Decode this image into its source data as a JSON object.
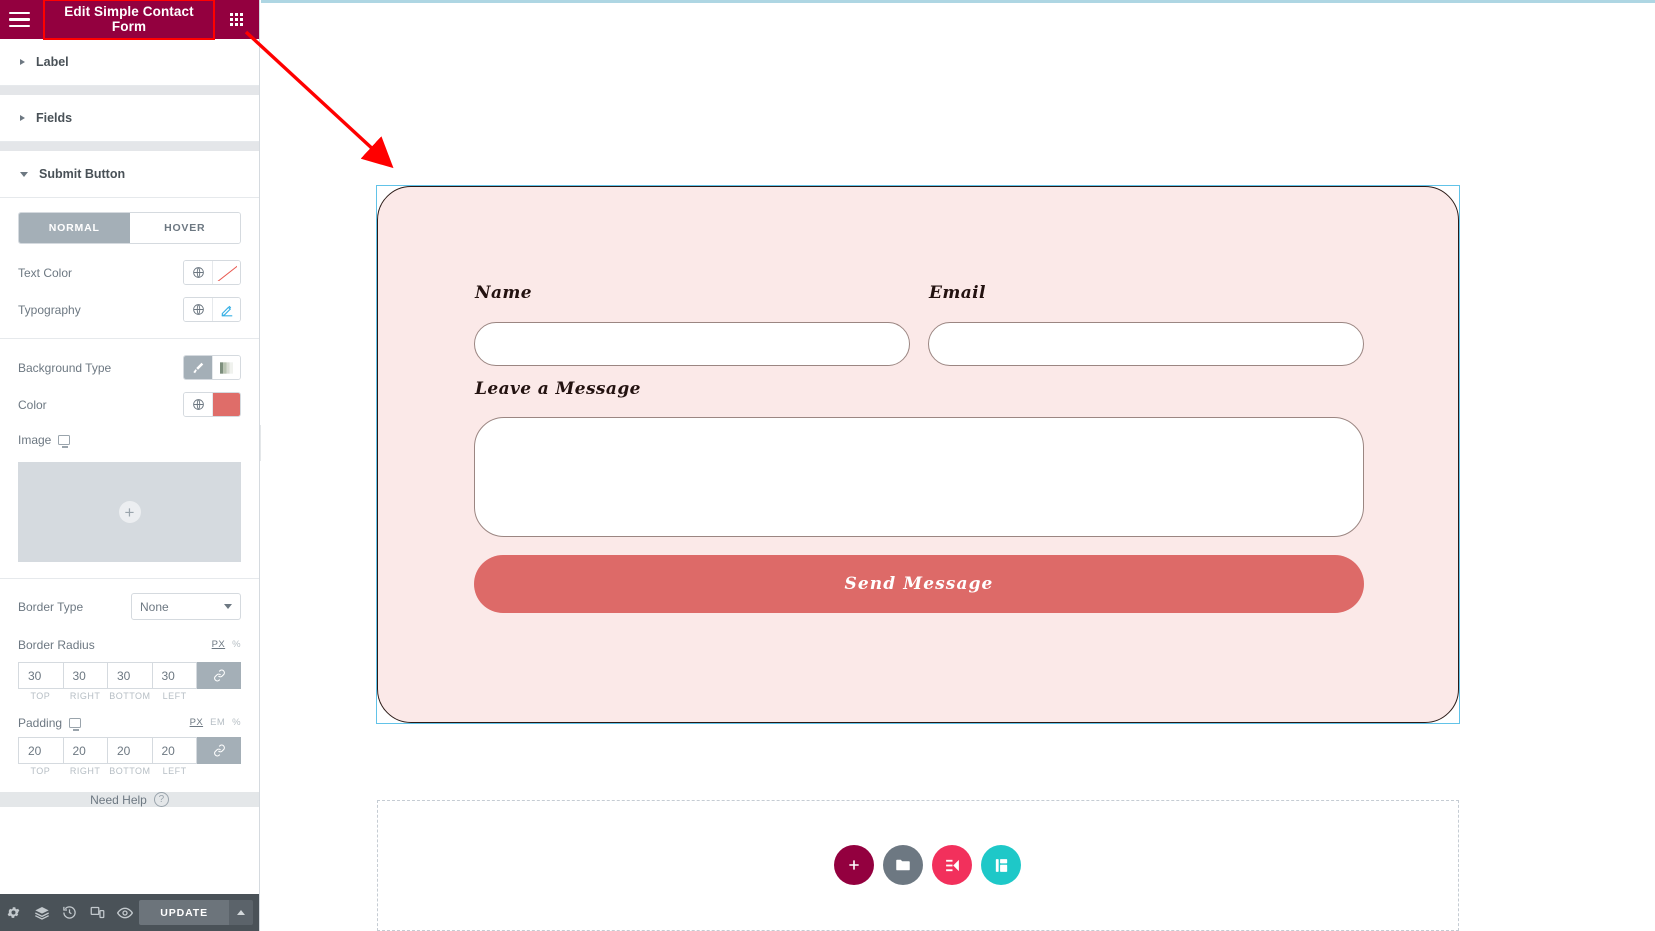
{
  "panel": {
    "header": {
      "title": "Edit Simple Contact Form",
      "menu_icon": "hamburger-icon",
      "grid_icon": "widgets-grid-icon",
      "background_color": "#93003f",
      "highlight_color": "#ff0000"
    },
    "sections": [
      {
        "label": "Label",
        "expanded": false
      },
      {
        "label": "Fields",
        "expanded": false
      },
      {
        "label": "Submit Button",
        "expanded": true
      }
    ],
    "submit_button": {
      "tabs": [
        {
          "label": "NORMAL",
          "active": true
        },
        {
          "label": "HOVER",
          "active": false
        }
      ],
      "controls": {
        "text_color": {
          "label": "Text Color",
          "globe_icon": "globe-icon",
          "value_icon": "no-color-slash-icon"
        },
        "typography": {
          "label": "Typography",
          "globe_icon": "globe-icon",
          "value_icon": "pencil-edit-icon"
        },
        "background_type": {
          "label": "Background Type",
          "options": [
            {
              "icon": "brush-classic-icon",
              "selected": true
            },
            {
              "icon": "gradient-icon",
              "selected": false
            }
          ]
        },
        "color": {
          "label": "Color",
          "globe_icon": "globe-icon",
          "swatch": "#d9534f"
        },
        "image": {
          "label": "Image",
          "device_icon": "desktop-icon",
          "add_icon": "plus-icon"
        },
        "border_type": {
          "label": "Border Type",
          "value": "None"
        },
        "border_radius": {
          "label": "Border Radius",
          "units": [
            {
              "label": "PX",
              "active": true
            },
            {
              "label": "%",
              "active": false
            }
          ],
          "values": [
            "30",
            "30",
            "30",
            "30"
          ],
          "sides": [
            "TOP",
            "RIGHT",
            "BOTTOM",
            "LEFT"
          ],
          "link_icon": "link-icon",
          "linked": true
        },
        "padding": {
          "label": "Padding",
          "device_icon": "desktop-icon",
          "units": [
            {
              "label": "PX",
              "active": true
            },
            {
              "label": "EM",
              "active": false
            },
            {
              "label": "%",
              "active": false
            }
          ],
          "values": [
            "20",
            "20",
            "20",
            "20"
          ],
          "sides": [
            "TOP",
            "RIGHT",
            "BOTTOM",
            "LEFT"
          ],
          "link_icon": "link-icon",
          "linked": true
        }
      }
    },
    "need_help": {
      "label": "Need Help",
      "icon": "question-mark-icon"
    },
    "footer": {
      "icons": [
        "settings-gear-icon",
        "layers-navigator-icon",
        "history-revisions-icon",
        "responsive-mode-icon",
        "preview-eye-icon"
      ],
      "update_label": "UPDATE",
      "update_arrow_icon": "chevron-up-icon"
    },
    "collapse_handle_icon": "chevron-left-icon"
  },
  "canvas": {
    "form": {
      "fields": [
        {
          "label": "Name",
          "value": "",
          "placeholder": ""
        },
        {
          "label": "Email",
          "value": "",
          "placeholder": ""
        },
        {
          "label": "Leave a Message",
          "value": "",
          "placeholder": ""
        }
      ],
      "submit_label": "Send Message",
      "background_color": "#fbe9e8",
      "button_color": "#dd6a68",
      "selection_color": "#62c3e8"
    },
    "fabs": [
      {
        "name": "add-section-button",
        "icon": "plus-icon",
        "color": "#93003f"
      },
      {
        "name": "add-template-button",
        "icon": "folder-icon",
        "color": "#6d7882"
      },
      {
        "name": "elementor-button",
        "icon": "elementor-logo-icon",
        "color": "#f2305c"
      },
      {
        "name": "element-pack-button",
        "icon": "element-pack-icon",
        "color": "#1ec8c8"
      }
    ]
  }
}
